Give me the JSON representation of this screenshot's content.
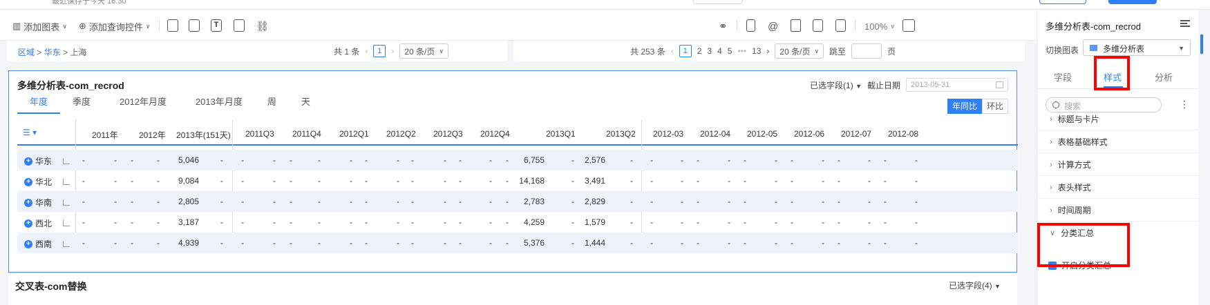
{
  "top": {
    "saved_text": "最近保存于今天 16:30"
  },
  "toolbar": {
    "add_chart": "添加图表",
    "add_filter": "添加查询控件",
    "zoom": "100%"
  },
  "left_strip": {
    "crumb_1": "区域",
    "crumb_2": "华东",
    "crumb_3": "上海",
    "total": "共 1 条",
    "page": "1",
    "per_page": "20 条/页"
  },
  "right_strip": {
    "total": "共 253 条",
    "pages": [
      "1",
      "2",
      "3",
      "4",
      "5",
      "•••",
      "13"
    ],
    "per_page": "20 条/页",
    "jump": "跳至",
    "page_unit": "页"
  },
  "card": {
    "title": "多维分析表-com_recrod",
    "selected_fields": "已选字段(1)",
    "cutoff_label": "截止日期",
    "cutoff_value": "2013-05-31",
    "tabs": [
      "年度",
      "季度",
      "2012年月度",
      "2013年月度",
      "周",
      "天"
    ],
    "compare_yoy": "年同比",
    "compare_mom": "环比",
    "headers": [
      "2011年",
      "2012年",
      "2013年(151天)",
      "2011Q3",
      "2011Q4",
      "2012Q1",
      "2012Q2",
      "2012Q3",
      "2012Q4",
      "2013Q1",
      "2013Q2",
      "2012-03",
      "2012-04",
      "2012-05",
      "2012-06",
      "2012-07",
      "2012-08"
    ],
    "rows": [
      {
        "name": "华东",
        "y2013": "5,046",
        "q1": "6,755",
        "q2": "2,576"
      },
      {
        "name": "华北",
        "y2013": "9,084",
        "q1": "14,168",
        "q2": "3,491"
      },
      {
        "name": "华南",
        "y2013": "2,805",
        "q1": "2,783",
        "q2": "2,829"
      },
      {
        "name": "西北",
        "y2013": "3,187",
        "q1": "4,259",
        "q2": "1,579"
      },
      {
        "name": "西南",
        "y2013": "4,939",
        "q1": "5,376",
        "q2": "1,444"
      }
    ],
    "dash": "-"
  },
  "card2": {
    "title": "交叉表-com替换",
    "selected_fields": "已选字段(4)"
  },
  "panel": {
    "title": "多维分析表-com_recrod",
    "switch_label": "切换图表",
    "switch_value": "多维分析表",
    "tabs": {
      "fields": "字段",
      "style": "样式",
      "analysis": "分析"
    },
    "search_placeholder": "搜索",
    "sections": [
      "标题与卡片",
      "表格基础样式",
      "计算方式",
      "表头样式",
      "时间周期",
      "分类汇总"
    ],
    "checkbox_label": "开启分类汇总"
  },
  "colors": {
    "accent": "#2f7ff6",
    "highlight": "#ff0000"
  }
}
